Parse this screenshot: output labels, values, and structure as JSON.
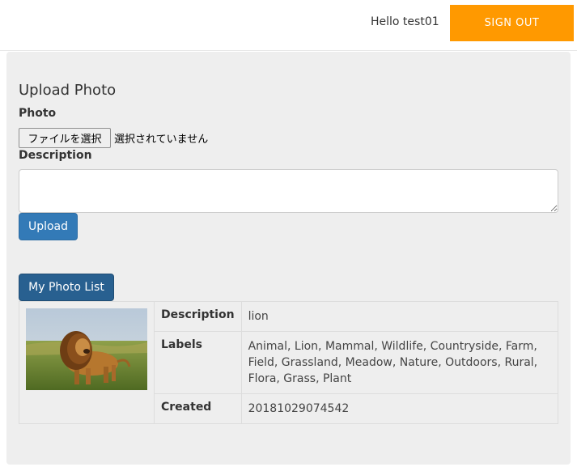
{
  "header": {
    "greeting": "Hello test01",
    "sign_out_label": "SIGN OUT"
  },
  "upload_form": {
    "title": "Upload Photo",
    "photo_label": "Photo",
    "file_button_label": "ファイルを選択",
    "file_status": "選択されていません",
    "description_label": "Description",
    "description_value": "",
    "upload_button_label": "Upload"
  },
  "photo_list": {
    "button_label": "My Photo List",
    "items": [
      {
        "image_subject": "lion",
        "rows": [
          {
            "key": "Description",
            "value": "lion"
          },
          {
            "key": "Labels",
            "value": "Animal, Lion, Mammal, Wildlife, Countryside, Farm, Field, Grassland, Meadow, Nature, Outdoors, Rural, Flora, Grass, Plant"
          },
          {
            "key": "Created",
            "value": "20181029074542"
          }
        ]
      }
    ]
  },
  "colors": {
    "sign_out_bg": "#ff9900",
    "primary_button": "#337ab7",
    "list_button": "#286090",
    "panel_bg": "#eeeeee"
  }
}
